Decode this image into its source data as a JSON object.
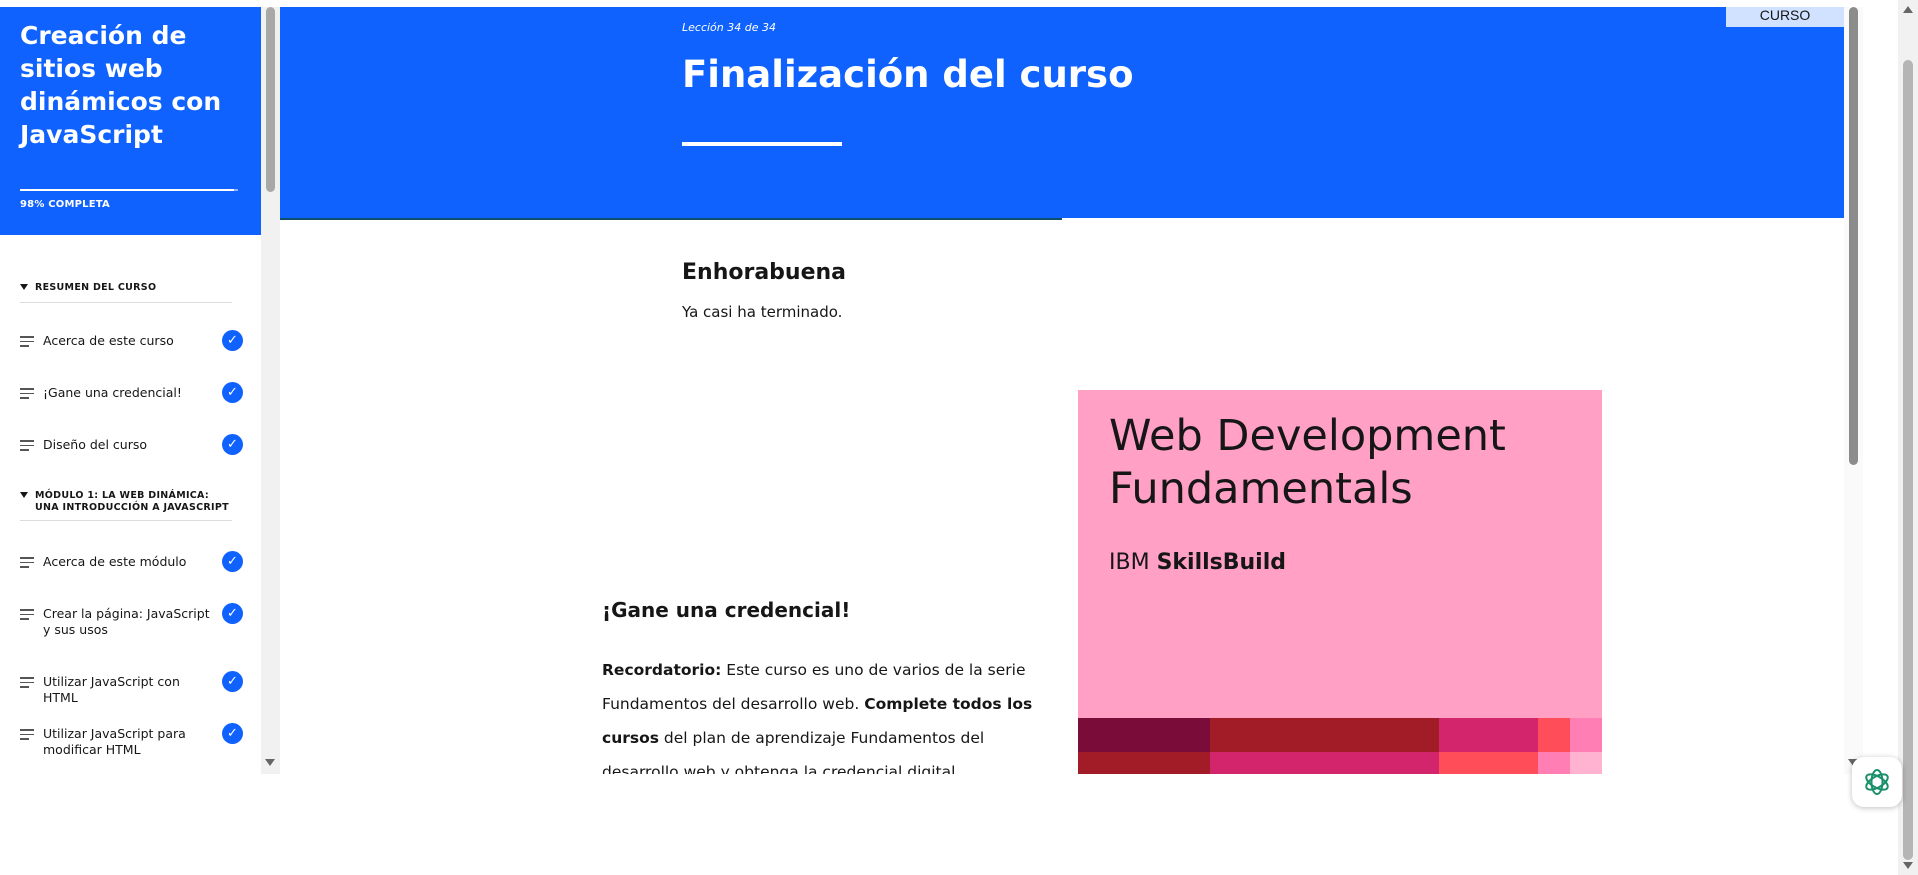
{
  "sidebar": {
    "course_title": "Creación de sitios web dinámicos con JavaScript",
    "progress_percent": 98,
    "progress_label": "98% COMPLETA",
    "sections": [
      {
        "title": "RESUMEN DEL CURSO",
        "lessons": [
          {
            "label": "Acerca de este curso",
            "completed": true
          },
          {
            "label": "¡Gane una credencial!",
            "completed": true
          },
          {
            "label": "Diseño del curso",
            "completed": true
          }
        ]
      },
      {
        "title": "MÓDULO 1: LA WEB DINÁMICA: UNA INTRODUCCIÓN A JAVASCRIPT",
        "lessons": [
          {
            "label": "Acerca de este módulo",
            "completed": true
          },
          {
            "label": "Crear la página: JavaScript y sus usos",
            "completed": true
          },
          {
            "label": "Utilizar JavaScript con HTML",
            "completed": true
          },
          {
            "label": "Utilizar JavaScript para modificar HTML",
            "completed": true
          }
        ]
      }
    ]
  },
  "header": {
    "lesson_counter": "Lección 34 de 34",
    "lesson_title": "Finalización del curso",
    "tab_label": "CURSO"
  },
  "content": {
    "congrats_title": "Enhorabuena",
    "congrats_text": "Ya casi ha terminado.",
    "credential_title": "¡Gane una credencial!",
    "credential_body": {
      "bold1": "Recordatorio:",
      "text1": " Este curso es uno de varios de la serie Fundamentos del desarrollo web. ",
      "bold2": "Complete todos los cursos",
      "text2": " del plan de aprendizaje Fundamentos del desarrollo web y obtenga la credencial digital"
    },
    "badge": {
      "title": "Web Development Fundamentals",
      "brand_prefix": "IBM",
      "brand_name": "SkillsBuild"
    }
  },
  "colors": {
    "brand_blue": "#0f62fe",
    "badge_pink": "#ffa0c4",
    "check_blue": "#0f62fe"
  },
  "icons": {
    "lesson": "lines-icon",
    "completed": "checkmark-icon",
    "assistant": "assistant-icon"
  }
}
